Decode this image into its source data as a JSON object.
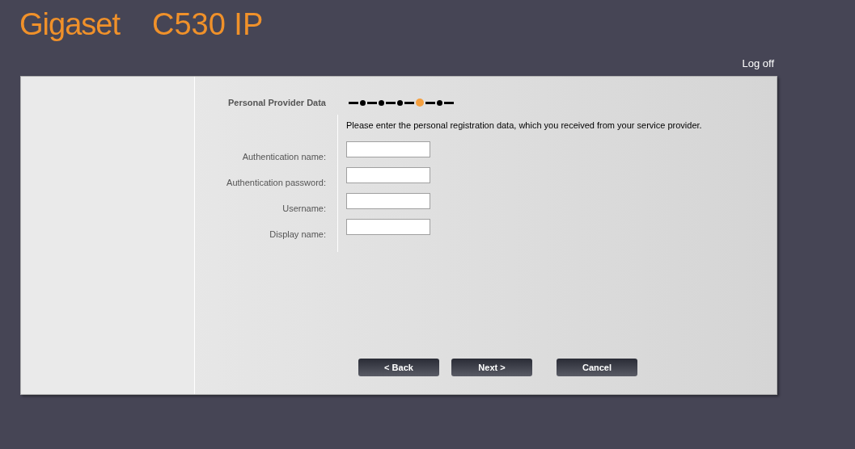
{
  "header": {
    "logo": "Gigaset",
    "model": "C530 IP",
    "logoff": "Log off"
  },
  "wizard": {
    "title": "Personal Provider Data",
    "steps": [
      {
        "selected": false
      },
      {
        "selected": false
      },
      {
        "selected": false
      },
      {
        "selected": true
      },
      {
        "selected": false
      }
    ],
    "instruction": "Please enter the personal registration data, which you received from your service provider.",
    "fields": [
      {
        "label": "Authentication name:"
      },
      {
        "label": "Authentication password:"
      },
      {
        "label": "Username:"
      },
      {
        "label": "Display name:"
      }
    ],
    "buttons": [
      "< Back",
      "Next >",
      "Cancel"
    ]
  }
}
